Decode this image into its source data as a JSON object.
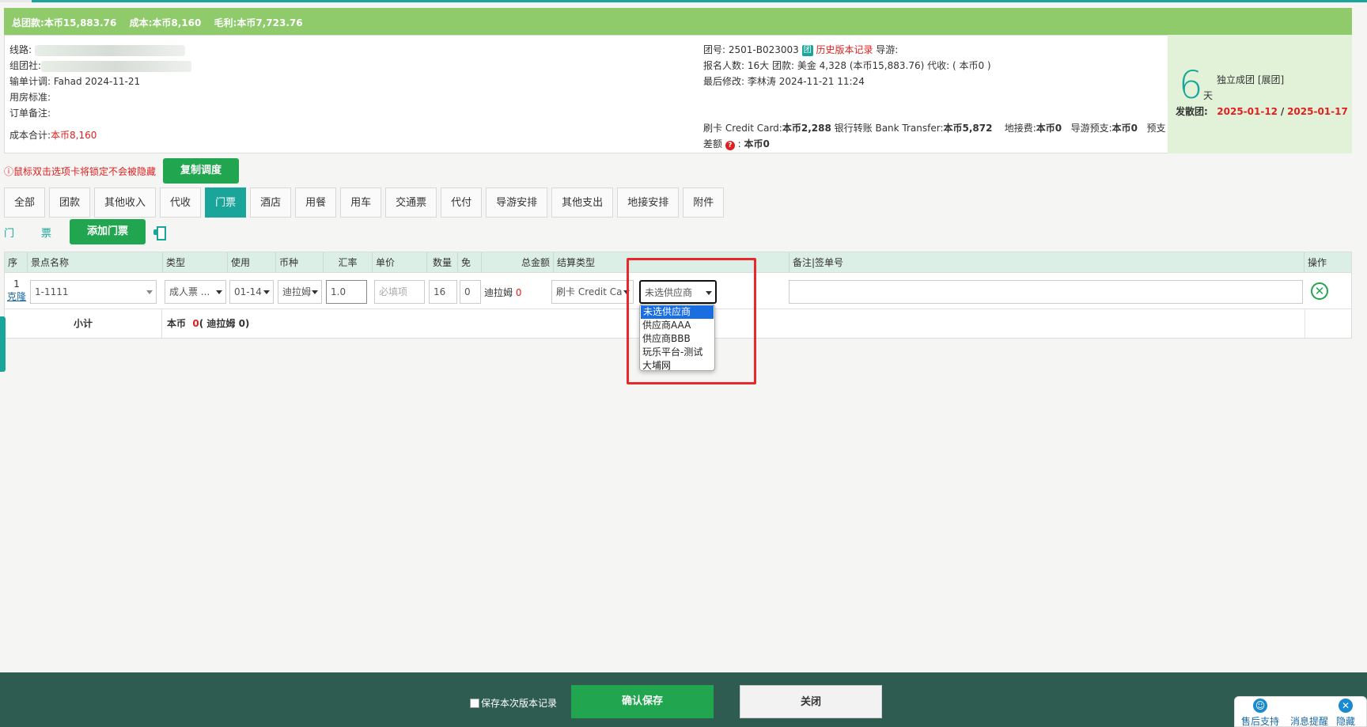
{
  "summary": {
    "total_receipt_label": "总团款:",
    "total_receipt_value": "本币15,883.76",
    "cost_label": "成本:",
    "cost_value": "本币8,160",
    "profit_label": "毛利:",
    "profit_value": "本币7,723.76"
  },
  "info": {
    "route_label": "线路:",
    "organizer_label": "组团社:",
    "entry_plan_label": "输单计调:",
    "entry_plan_value": "Fahad 2024-11-21",
    "room_std_label": "用房标准:",
    "order_note_label": "订单备注:",
    "cost_total_label": "成本合计:",
    "cost_total_value": "本币8,160",
    "group_no_label": "团号:",
    "group_no_value": "2501-B023003",
    "group_no_icon": "团",
    "history_link": "历史版本记录",
    "guide_label": "导游:",
    "signup_label": "报名人数:",
    "signup_value": "16大",
    "group_fee_label": "团款:",
    "group_fee_value": "美金 4,328 (本币15,883.76)",
    "collect_label": "代收:",
    "collect_value": "( 本币0 )",
    "last_modified_label": "最后修改:",
    "last_modified_value": "李林涛 2024-11-21 11:24",
    "card_label": "刷卡 Credit Card:",
    "card_value": "本币2,288",
    "bank_label": "银行转账 Bank Transfer:",
    "bank_value": "本币5,872",
    "ground_fee_label": "地接费:",
    "ground_fee_value": "本币0",
    "guide_prepay_label": "导游预支:",
    "guide_prepay_value": "本币0",
    "prepay_label": "预支",
    "diff_label": "差额",
    "diff_icon": "?",
    "diff_value": "本币0"
  },
  "days_panel": {
    "days": "6",
    "days_unit": "天",
    "group_type": "独立成团 [展团]",
    "depart_label": "发散团:",
    "depart_start": "2025-01-12",
    "date_sep": "/",
    "depart_end": "2025-01-17"
  },
  "tip": {
    "text": "鼠标双击选项卡将锁定不会被隐藏",
    "copy_button": "复制调度"
  },
  "tabs": [
    "全部",
    "团款",
    "其他收入",
    "代收",
    "门票",
    "酒店",
    "用餐",
    "用车",
    "交通票",
    "代付",
    "导游安排",
    "其他支出",
    "地接安排",
    "附件"
  ],
  "active_tab": 4,
  "ticket_section": {
    "label_a": "门",
    "label_b": "票",
    "add_button": "添加门票"
  },
  "table": {
    "headers": {
      "seq": "序",
      "spot": "景点名称",
      "type": "类型",
      "use": "使用",
      "currency": "币种",
      "rate": "汇率",
      "unit_price": "单价",
      "qty": "数量",
      "free": "免",
      "total": "总金额",
      "settle": "结算类型",
      "remark": "备注|签单号",
      "ops": "操作"
    },
    "row": {
      "seq": "1",
      "clone_link": "克隆",
      "spot": "1-1111",
      "type": "成人票 ...",
      "use": "01-14",
      "currency": "迪拉姆",
      "rate": "1.0",
      "unit_price_placeholder": "必填项",
      "qty": "16",
      "free": "0",
      "total_currency": "迪拉姆",
      "total_value": "0",
      "settle": "刷卡 Credit Ca",
      "supplier": "未选供应商",
      "remark": ""
    },
    "subtotal": {
      "label": "小计",
      "currency": "本币",
      "value": "0",
      "detail": "( 迪拉姆 0)"
    }
  },
  "supplier_dropdown": {
    "options": [
      "未选供应商",
      "供应商AAA",
      "供应商BBB",
      "玩乐平台-测试",
      "大埔网"
    ],
    "selected": 0
  },
  "footer": {
    "save_version_label": "保存本次版本记录",
    "confirm_button": "确认保存",
    "close_button": "关闭"
  },
  "help_widget": {
    "support": "售后支持",
    "messages": "消息提醒",
    "hide": "隐藏"
  },
  "colors": {
    "summary_bar": "#8fca6b",
    "teal_accent": "#1aa59b",
    "green_button": "#21a64f",
    "footer": "#2e5c50",
    "highlight_red": "#e8282a"
  }
}
